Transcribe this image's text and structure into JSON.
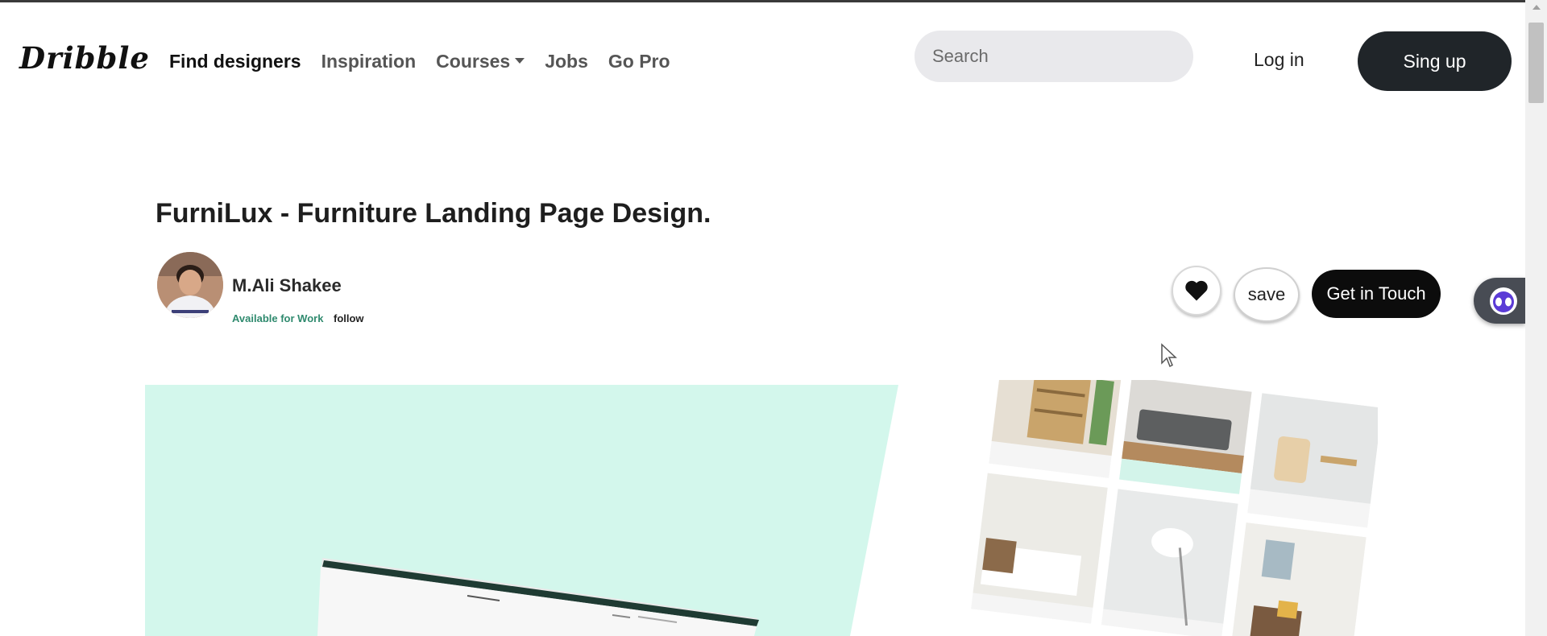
{
  "header": {
    "logo": "Dribble",
    "nav": [
      {
        "label": "Find designers",
        "active": true
      },
      {
        "label": "Inspiration"
      },
      {
        "label": "Courses",
        "dropdown": true
      },
      {
        "label": "Jobs"
      },
      {
        "label": "Go Pro"
      }
    ],
    "search_placeholder": "Search",
    "login_label": "Log in",
    "signup_label": "Sing up"
  },
  "shot": {
    "title": "FurniLux - Furniture Landing Page Design.",
    "author_name": "M.Ali Shakee",
    "availability": "Available for Work",
    "follow_label": "follow",
    "save_label": "save",
    "contact_label": "Get in Touch"
  },
  "icons": {
    "like": "heart-icon",
    "chat": "chatbot-icon",
    "cursor": "mouse-cursor-icon"
  },
  "colors": {
    "accent_mint": "#d3f7ec",
    "signup_bg": "#202529",
    "contact_bg": "#0c0c0c",
    "availability": "#2f8a6e"
  }
}
